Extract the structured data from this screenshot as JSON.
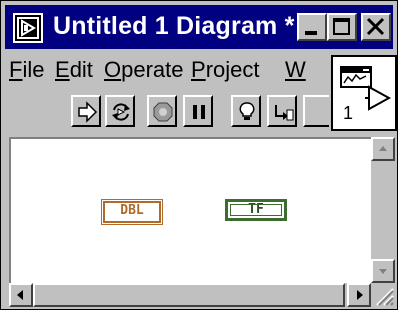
{
  "window": {
    "title": "Untitled 1 Diagram *",
    "caption_buttons": [
      "minimize",
      "maximize",
      "close"
    ]
  },
  "menu": {
    "items": [
      {
        "label": "File",
        "mnemonic": "F"
      },
      {
        "label": "Edit",
        "mnemonic": "E"
      },
      {
        "label": "Operate",
        "mnemonic": "O"
      },
      {
        "label": "Project",
        "mnemonic": "P"
      },
      {
        "label": "W",
        "mnemonic": "W"
      }
    ]
  },
  "toolbar": {
    "buttons": [
      "run-icon",
      "run-continuously-icon",
      "abort-icon",
      "pause-icon",
      "highlight-execution-icon",
      "step-into-icon"
    ]
  },
  "palette": {
    "icon": "vi-connector-pane-icon",
    "number": "1"
  },
  "diagram": {
    "terminals": [
      {
        "label": "DBL",
        "color": "#b06a2c"
      },
      {
        "label": "TF",
        "color": "#3e6b2e"
      }
    ]
  },
  "colors": {
    "titlebar": "#000080",
    "chrome": "#c0c0c0",
    "canvas": "#ffffff"
  }
}
